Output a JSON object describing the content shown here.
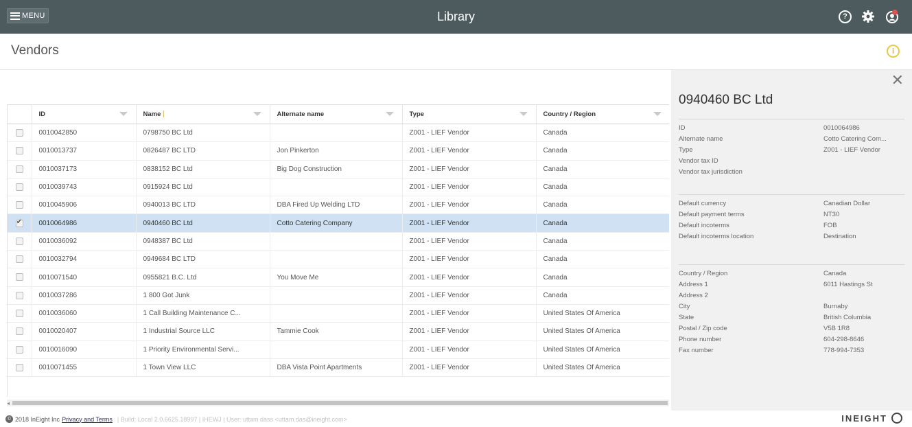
{
  "topbar": {
    "menu_label": "MENU",
    "app_title": "Library"
  },
  "page": {
    "title": "Vendors"
  },
  "grid": {
    "columns": [
      "ID",
      "Name",
      "Alternate name",
      "Type",
      "Country / Region"
    ],
    "rows": [
      {
        "checked": false,
        "id": "0010042850",
        "name": "0798750 BC Ltd",
        "alt": "",
        "type": "Z001 - LIEF Vendor",
        "country": "Canada"
      },
      {
        "checked": false,
        "id": "0010013737",
        "name": "0826487 BC LTD",
        "alt": "Jon Pinkerton",
        "type": "Z001 - LIEF Vendor",
        "country": "Canada"
      },
      {
        "checked": false,
        "id": "0010037173",
        "name": "0838152 BC Ltd",
        "alt": "Big Dog Construction",
        "type": "Z001 - LIEF Vendor",
        "country": "Canada"
      },
      {
        "checked": false,
        "id": "0010039743",
        "name": "0915924 BC Ltd",
        "alt": "",
        "type": "Z001 - LIEF Vendor",
        "country": "Canada"
      },
      {
        "checked": false,
        "id": "0010045906",
        "name": "0940013 BC LTD",
        "alt": "DBA Fired Up Welding LTD",
        "type": "Z001 - LIEF Vendor",
        "country": "Canada"
      },
      {
        "checked": true,
        "id": "0010064986",
        "name": "0940460 BC Ltd",
        "alt": "Cotto Catering Company",
        "type": "Z001 - LIEF Vendor",
        "country": "Canada"
      },
      {
        "checked": false,
        "id": "0010036092",
        "name": "0948387 BC Ltd",
        "alt": "",
        "type": "Z001 - LIEF Vendor",
        "country": "Canada"
      },
      {
        "checked": false,
        "id": "0010032794",
        "name": "0949684 BC LTD",
        "alt": "",
        "type": "Z001 - LIEF Vendor",
        "country": "Canada"
      },
      {
        "checked": false,
        "id": "0010071540",
        "name": "0955821 B.C. Ltd",
        "alt": "You Move Me",
        "type": "Z001 - LIEF Vendor",
        "country": "Canada"
      },
      {
        "checked": false,
        "id": "0010037286",
        "name": "1 800 Got Junk",
        "alt": "",
        "type": "Z001 - LIEF Vendor",
        "country": "Canada"
      },
      {
        "checked": false,
        "id": "0010036060",
        "name": "1 Call Building Maintenance C...",
        "alt": "",
        "type": "Z001 - LIEF Vendor",
        "country": "United States Of America"
      },
      {
        "checked": false,
        "id": "0010020407",
        "name": "1 Industrial Source LLC",
        "alt": "Tammie Cook",
        "type": "Z001 - LIEF Vendor",
        "country": "United States Of America"
      },
      {
        "checked": false,
        "id": "0010016090",
        "name": "1 Priority Environmental Servi...",
        "alt": "",
        "type": "Z001 - LIEF Vendor",
        "country": "United States Of America"
      },
      {
        "checked": false,
        "id": "0010071455",
        "name": "1 Town View LLC",
        "alt": "DBA Vista Point Apartments",
        "type": "Z001 - LIEF Vendor",
        "country": "United States Of America"
      }
    ]
  },
  "detail": {
    "title": "0940460 BC Ltd",
    "sections": [
      [
        {
          "label": "ID",
          "value": "0010064986"
        },
        {
          "label": "Alternate name",
          "value": "Cotto Catering Com..."
        },
        {
          "label": "Type",
          "value": "Z001 - LIEF Vendor"
        },
        {
          "label": "Vendor tax ID",
          "value": ""
        },
        {
          "label": "Vendor tax jurisdiction",
          "value": ""
        }
      ],
      [
        {
          "label": "Default currency",
          "value": "Canadian Dollar"
        },
        {
          "label": "Default payment terms",
          "value": "NT30"
        },
        {
          "label": "Default incoterms",
          "value": "FOB"
        },
        {
          "label": "Default incoterms location",
          "value": "Destination"
        }
      ],
      [
        {
          "label": "Country / Region",
          "value": "Canada"
        },
        {
          "label": "Address 1",
          "value": "6011 Hastings St"
        },
        {
          "label": "Address 2",
          "value": ""
        },
        {
          "label": "City",
          "value": "Burnaby"
        },
        {
          "label": "State",
          "value": "British Columbia"
        },
        {
          "label": "Postal / Zip code",
          "value": "V5B 1R8"
        },
        {
          "label": "Phone number",
          "value": "604-298-8646"
        },
        {
          "label": "Fax number",
          "value": "778-994-7353"
        }
      ]
    ]
  },
  "footer": {
    "copyright": "2018 InEight Inc",
    "privacy_link": "Privacy and Terms",
    "meta": "| Build: Local 2.0.6625.18997 | IHEWJ | User: uttam dass <uttam.das@ineight.com>",
    "brand": "INEIGHT"
  },
  "colors": {
    "topbar": "#4d5b5f",
    "selected_row": "#cfe1f2",
    "panel_bg": "#f1f1f1",
    "info_accent": "#e8c84c"
  }
}
